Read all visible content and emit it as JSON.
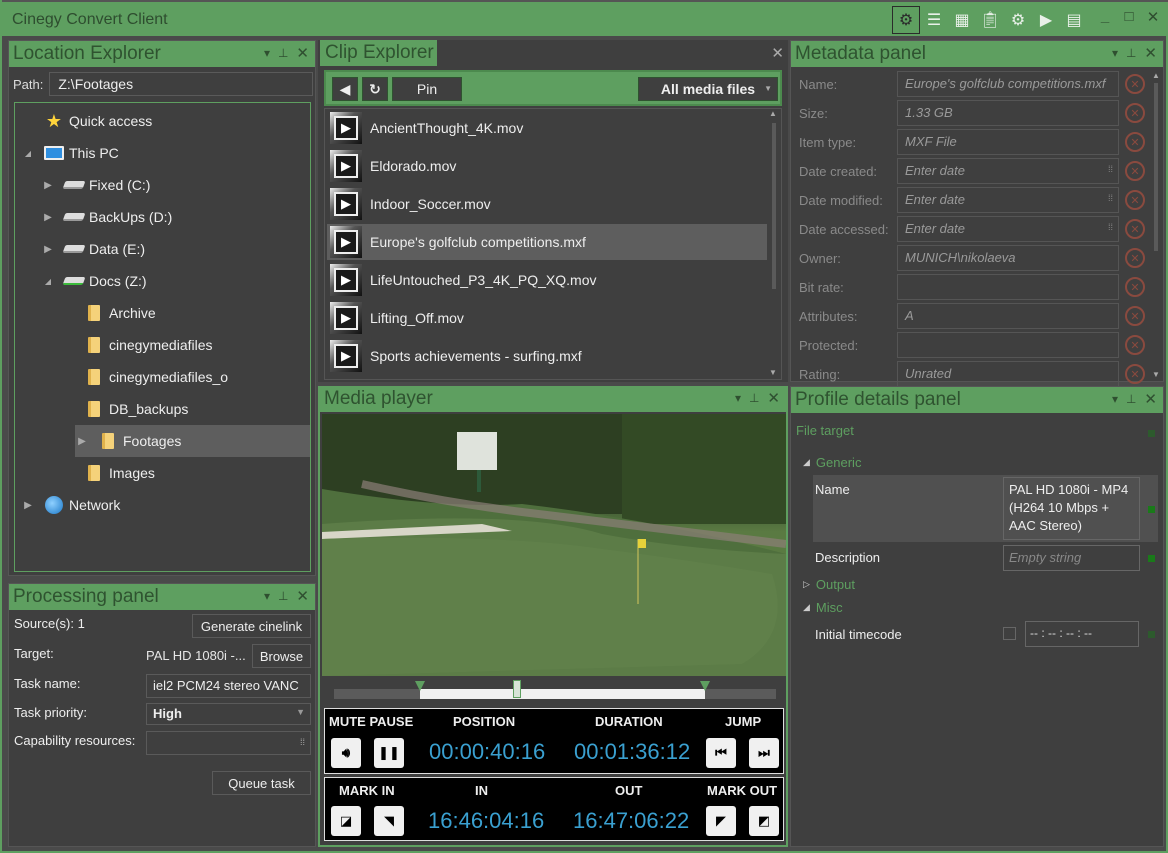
{
  "app": {
    "title": "Cinegy Convert Client",
    "toolbar_icons": [
      "settings-gear",
      "align-left",
      "grid-tiles",
      "clipboard",
      "gears",
      "play-box",
      "list-box"
    ],
    "window_controls": [
      "minimize",
      "maximize",
      "close"
    ]
  },
  "location_explorer": {
    "title": "Location Explorer",
    "path_label": "Path:",
    "path_value": "Z:\\Footages",
    "tree": [
      {
        "label": "Quick access",
        "icon": "star",
        "expand": "",
        "level": 0
      },
      {
        "label": "This PC",
        "icon": "pc",
        "expand": "◢",
        "level": 0
      },
      {
        "label": "Fixed (C:)",
        "icon": "drive-windows",
        "expand": "▶",
        "level": 1
      },
      {
        "label": "BackUps (D:)",
        "icon": "drive",
        "expand": "▶",
        "level": 1
      },
      {
        "label": "Data (E:)",
        "icon": "drive",
        "expand": "▶",
        "level": 1
      },
      {
        "label": "Docs (Z:)",
        "icon": "drive-network",
        "expand": "◢",
        "level": 1
      },
      {
        "label": "Archive",
        "icon": "folder",
        "expand": "",
        "level": 2
      },
      {
        "label": "cinegymediafiles",
        "icon": "folder",
        "expand": "",
        "level": 2
      },
      {
        "label": "cinegymediafiles_o",
        "icon": "folder",
        "expand": "",
        "level": 2
      },
      {
        "label": "DB_backups",
        "icon": "folder",
        "expand": "",
        "level": 2
      },
      {
        "label": "Footages",
        "icon": "folder",
        "expand": "▶",
        "level": 2,
        "selected": true
      },
      {
        "label": "Images",
        "icon": "folder",
        "expand": "",
        "level": 2
      },
      {
        "label": "Network",
        "icon": "globe",
        "expand": "▶",
        "level": 0
      }
    ]
  },
  "processing_panel": {
    "title": "Processing panel",
    "sources_label": "Source(s): 1",
    "generate_cinelink": "Generate cinelink",
    "target_label": "Target:",
    "target_value": "PAL HD 1080i -...",
    "browse": "Browse",
    "task_name_label": "Task name:",
    "task_name_value": "iel2 PCM24 stereo VANC",
    "task_priority_label": "Task priority:",
    "task_priority_value": "High",
    "capability_label": "Capability resources:",
    "capability_value": "",
    "queue_task": "Queue task"
  },
  "clip_explorer": {
    "title": "Clip Explorer",
    "pin": "Pin",
    "filter": "All media files",
    "clips": [
      {
        "name": "AncientThought_4K.mov"
      },
      {
        "name": "Eldorado.mov"
      },
      {
        "name": "Indoor_Soccer.mov"
      },
      {
        "name": "Europe's golfclub competitions.mxf",
        "selected": true
      },
      {
        "name": "LifeUntouched_P3_4K_PQ_XQ.mov"
      },
      {
        "name": "Lifting_Off.mov"
      },
      {
        "name": "Sports achievements - surfing.mxf"
      }
    ]
  },
  "media_player": {
    "title": "Media player",
    "mark_in_fraction": 0.195,
    "mark_out_fraction": 0.84,
    "playhead_fraction": 0.415,
    "labels": {
      "mute_pause": "MUTE PAUSE",
      "position": "POSITION",
      "duration": "DURATION",
      "jump": "JUMP",
      "mark_in": "MARK IN",
      "in": "IN",
      "out": "OUT",
      "mark_out": "MARK OUT"
    },
    "position": "00:00:40:16",
    "duration": "00:01:36:12",
    "in": "16:46:04:16",
    "out": "16:47:06:22"
  },
  "metadata_panel": {
    "title": "Metadata panel",
    "rows": [
      {
        "label": "Name:",
        "value": "Europe's golfclub competitions.mxf",
        "picker": false
      },
      {
        "label": "Size:",
        "value": "1.33 GB",
        "picker": false
      },
      {
        "label": "Item type:",
        "value": "MXF File",
        "picker": false
      },
      {
        "label": "Date created:",
        "value": "Enter date",
        "picker": true
      },
      {
        "label": "Date modified:",
        "value": "Enter date",
        "picker": true
      },
      {
        "label": "Date accessed:",
        "value": "Enter date",
        "picker": true
      },
      {
        "label": "Owner:",
        "value": "MUNICH\\nikolaeva",
        "picker": false
      },
      {
        "label": "Bit rate:",
        "value": "",
        "picker": false
      },
      {
        "label": "Attributes:",
        "value": "A",
        "picker": false
      },
      {
        "label": "Protected:",
        "value": "",
        "picker": false
      },
      {
        "label": "Rating:",
        "value": "Unrated",
        "picker": false
      }
    ]
  },
  "profile_panel": {
    "title": "Profile details panel",
    "file_target": "File target",
    "generic": "Generic",
    "name_label": "Name",
    "name_value": "PAL HD 1080i - MP4 (H264 10 Mbps + AAC Stereo)",
    "description_label": "Description",
    "description_placeholder": "Empty string",
    "output": "Output",
    "misc": "Misc",
    "initial_timecode_label": "Initial timecode",
    "initial_timecode_value": "-- : -- : -- : --"
  }
}
